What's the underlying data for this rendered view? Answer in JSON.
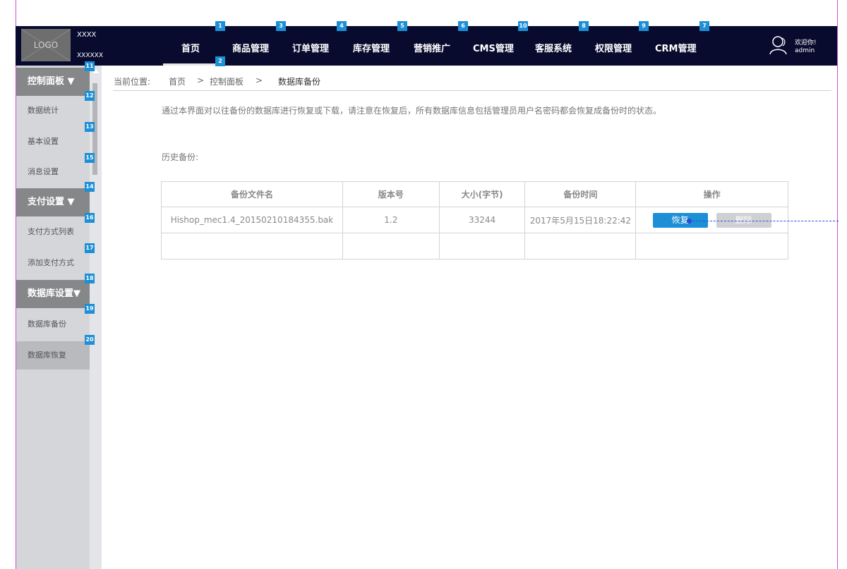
{
  "header": {
    "logo": "LOGO",
    "brand_line1": "XXXX",
    "brand_line2": "XXXXXX",
    "nav": [
      {
        "label": "首页",
        "badge": "1"
      },
      {
        "label": "商品管理",
        "badge": "3"
      },
      {
        "label": "订单管理",
        "badge": "4"
      },
      {
        "label": "库存管理",
        "badge": "5"
      },
      {
        "label": "营销推广",
        "badge": "6"
      },
      {
        "label": "CMS管理",
        "badge": "10"
      },
      {
        "label": "客服系统",
        "badge": "8"
      },
      {
        "label": "权限管理",
        "badge": "9"
      },
      {
        "label": "CRM管理",
        "badge": "7"
      }
    ],
    "home_underline_badge": "2",
    "welcome": "欢迎你!",
    "username": "admin"
  },
  "sidebar": {
    "groups": [
      {
        "label": "控制面板 ▼",
        "badge": "11"
      },
      {
        "label": "支付设置 ▼",
        "badge": "14"
      },
      {
        "label": "数据库设置▼",
        "badge": "18"
      }
    ],
    "items": [
      {
        "label": "数据统计",
        "badge": "12"
      },
      {
        "label": "基本设置",
        "badge": "13"
      },
      {
        "label": "消息设置",
        "badge": "15"
      },
      {
        "label": "支付方式列表",
        "badge": "16"
      },
      {
        "label": "添加支付方式",
        "badge": "17"
      },
      {
        "label": "数据库备份",
        "badge": "19"
      },
      {
        "label": "数据库恢复",
        "badge": "20"
      }
    ]
  },
  "breadcrumb": {
    "prefix": "当前位置:",
    "home": "首页",
    "sep": ">",
    "level1": "控制面板",
    "current": "数据库备份"
  },
  "content": {
    "intro": "通过本界面对以往备份的数据库进行恢复或下载，请注意在恢复后，所有数据库信息包括管理员用户名密码都会恢复成备份时的状态。",
    "history_label": "历史备份:",
    "table": {
      "headers": [
        "备份文件名",
        "版本号",
        "大小(字节)",
        "备份时间",
        "操作"
      ],
      "rows": [
        {
          "filename": "Hishop_mec1.4_20150210184355.bak",
          "version": "1.2",
          "size": "33244",
          "time": "2017年5月15日18:22:42",
          "restore": "恢复",
          "delete": "删除"
        }
      ]
    }
  },
  "colors": {
    "topbar": "#080b2e",
    "accent": "#1c8fd6",
    "sidebar": "#d5d6d9",
    "sidebar_head": "#868789",
    "guide": "#d24bd6"
  }
}
